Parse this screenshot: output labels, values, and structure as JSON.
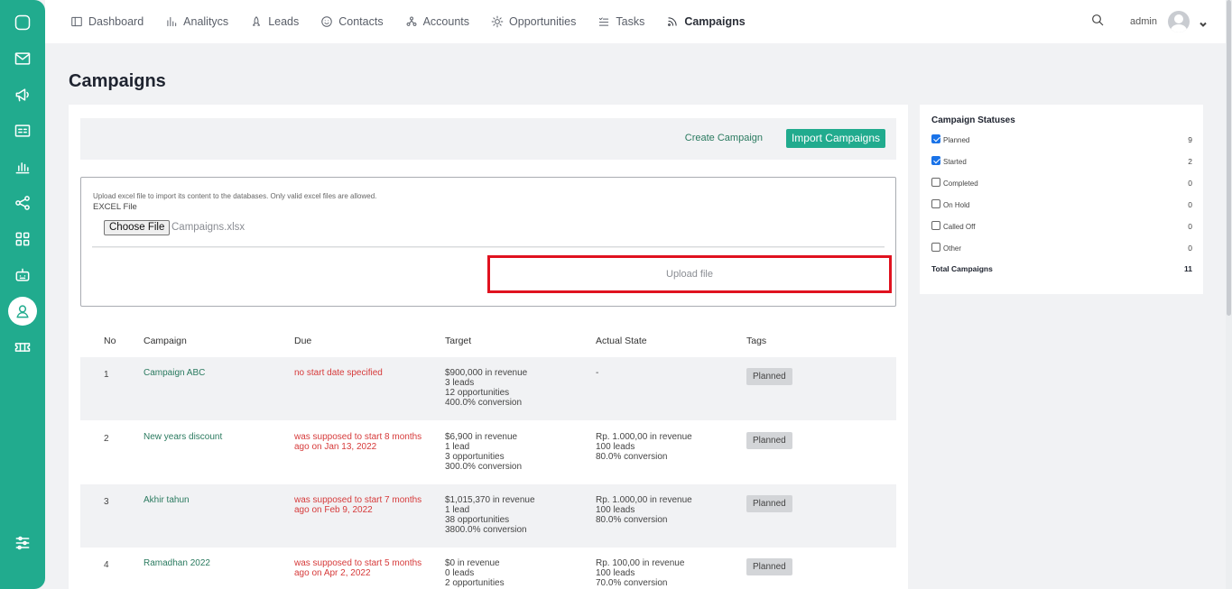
{
  "nav": {
    "items": [
      {
        "label": "Dashboard",
        "icon": "dashboard-icon"
      },
      {
        "label": "Analitycs",
        "icon": "analytics-icon"
      },
      {
        "label": "Leads",
        "icon": "leads-icon"
      },
      {
        "label": "Contacts",
        "icon": "contacts-icon"
      },
      {
        "label": "Accounts",
        "icon": "accounts-icon"
      },
      {
        "label": "Opportunities",
        "icon": "opportunities-icon"
      },
      {
        "label": "Tasks",
        "icon": "tasks-icon"
      },
      {
        "label": "Campaigns",
        "icon": "campaigns-icon"
      }
    ],
    "active": "Campaigns",
    "user": "admin"
  },
  "page": {
    "title": "Campaigns"
  },
  "toolbar": {
    "create_label": "Create Campaign",
    "import_label": "Import Campaigns"
  },
  "upload": {
    "hint": "Upload excel file to import its content to the databases. Only valid excel files are allowed.",
    "field_label": "EXCEL File",
    "choose_label": "Choose File",
    "file_name": "Campaigns.xlsx",
    "submit_label": "Upload file"
  },
  "table": {
    "headers": {
      "no": "No",
      "campaign": "Campaign",
      "due": "Due",
      "target": "Target",
      "actual": "Actual State",
      "tags": "Tags"
    },
    "rows": [
      {
        "no": "1",
        "campaign": "Campaign ABC",
        "due": "no start date specified",
        "target": [
          "$900,000 in revenue",
          "3 leads",
          "12 opportunities",
          "400.0% conversion"
        ],
        "actual": [
          "-"
        ],
        "tag": "Planned"
      },
      {
        "no": "2",
        "campaign": "New years discount",
        "due": "was supposed to start 8 months ago on Jan 13, 2022",
        "target": [
          "$6,900 in revenue",
          "1 lead",
          "3 opportunities",
          "300.0% conversion"
        ],
        "actual": [
          "Rp. 1.000,00 in revenue",
          "100 leads",
          "80.0% conversion"
        ],
        "tag": "Planned"
      },
      {
        "no": "3",
        "campaign": "Akhir tahun",
        "due": "was supposed to start 7 months ago on Feb 9, 2022",
        "target": [
          "$1,015,370 in revenue",
          "1 lead",
          "38 opportunities",
          "3800.0% conversion"
        ],
        "actual": [
          "Rp. 1.000,00 in revenue",
          "100 leads",
          "80.0% conversion"
        ],
        "tag": "Planned"
      },
      {
        "no": "4",
        "campaign": "Ramadhan 2022",
        "due": "was supposed to start 5 months ago on Apr 2, 2022",
        "target": [
          "$0 in revenue",
          "0 leads",
          "2 opportunities"
        ],
        "actual": [
          "Rp. 100,00 in revenue",
          "100 leads",
          "70.0% conversion"
        ],
        "tag": "Planned"
      }
    ]
  },
  "statuses": {
    "title": "Campaign Statuses",
    "items": [
      {
        "label": "Planned",
        "count": "9",
        "checked": true
      },
      {
        "label": "Started",
        "count": "2",
        "checked": true
      },
      {
        "label": "Completed",
        "count": "0",
        "checked": false
      },
      {
        "label": "On Hold",
        "count": "0",
        "checked": false
      },
      {
        "label": "Called Off",
        "count": "0",
        "checked": false
      },
      {
        "label": "Other",
        "count": "0",
        "checked": false
      }
    ],
    "total_label": "Total Campaigns",
    "total_count": "11"
  },
  "colors": {
    "brand": "#21ab8e",
    "due_red": "#d63a3a",
    "highlight_red": "#e0121f"
  }
}
